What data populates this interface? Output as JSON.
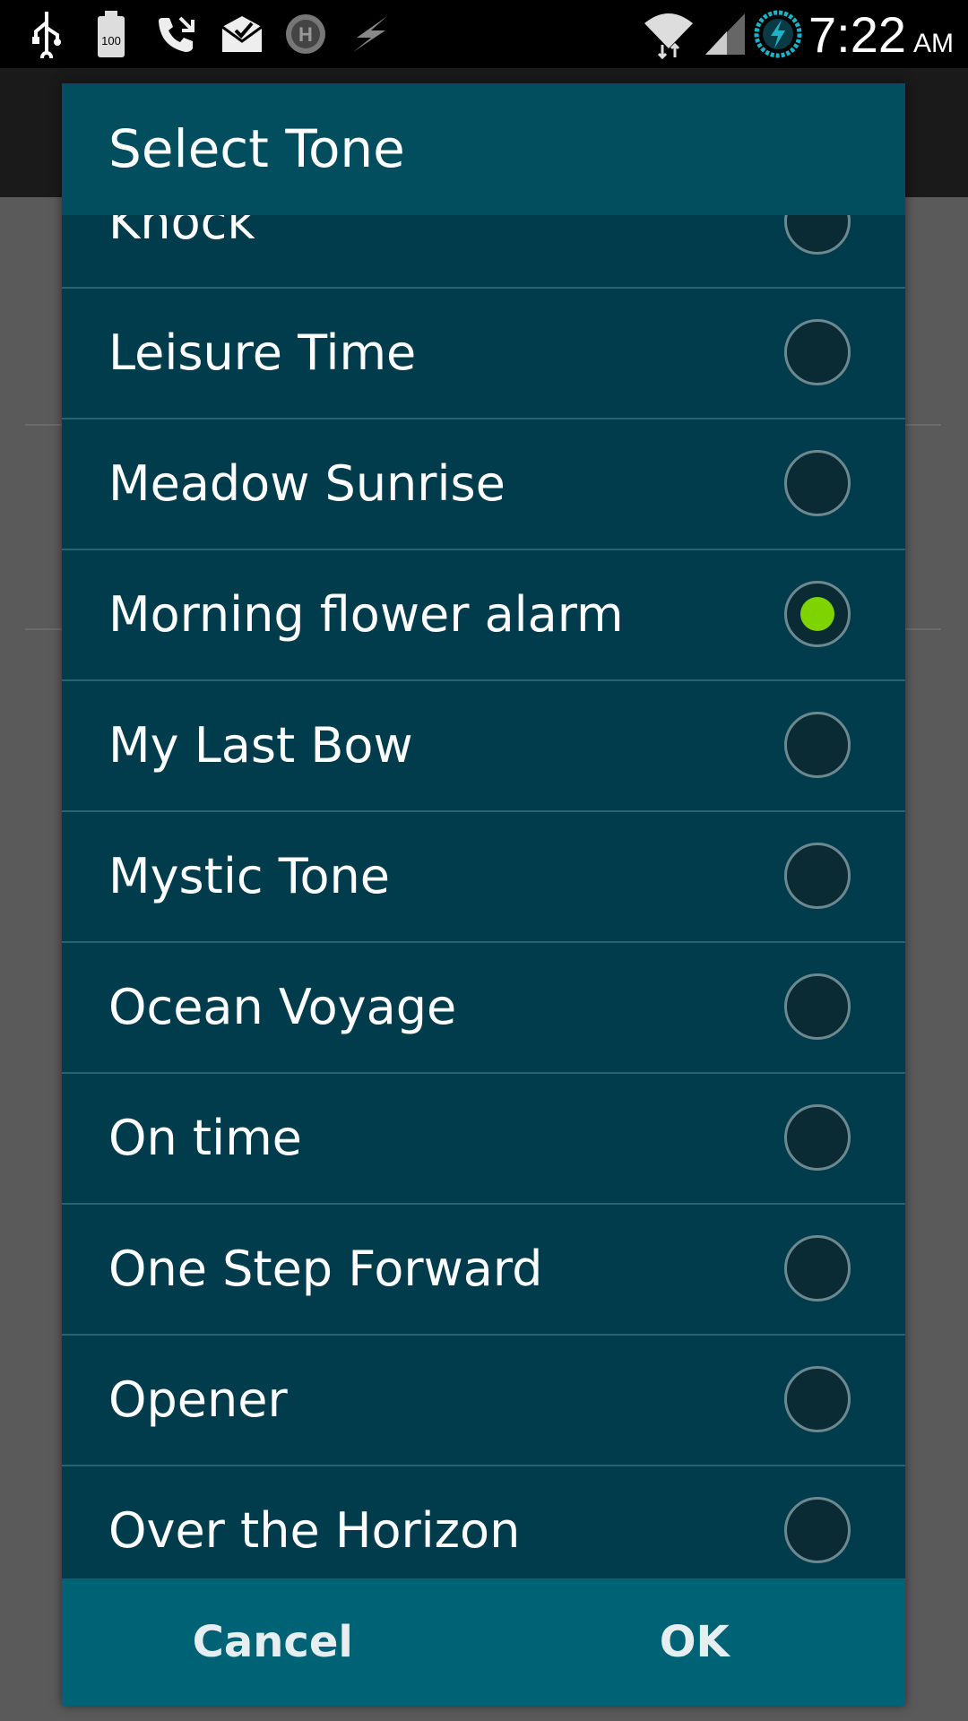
{
  "status_bar": {
    "time": "7:22",
    "ampm": "AM",
    "battery_level": "100",
    "icons_left": [
      "usb-icon",
      "battery-icon",
      "missed-call-icon",
      "mail-icon",
      "h-badge-icon",
      "flash-icon"
    ],
    "icons_right": [
      "wifi-icon",
      "signal-icon",
      "charging-ring-icon"
    ]
  },
  "dialog": {
    "title": "Select Tone",
    "items": [
      {
        "label": "Knock",
        "selected": false
      },
      {
        "label": "Leisure Time",
        "selected": false
      },
      {
        "label": "Meadow Sunrise",
        "selected": false
      },
      {
        "label": "Morning flower alarm",
        "selected": true
      },
      {
        "label": "My Last Bow",
        "selected": false
      },
      {
        "label": "Mystic Tone",
        "selected": false
      },
      {
        "label": "Ocean Voyage",
        "selected": false
      },
      {
        "label": "On time",
        "selected": false
      },
      {
        "label": "One Step Forward",
        "selected": false
      },
      {
        "label": "Opener",
        "selected": false
      },
      {
        "label": "Over the Horizon",
        "selected": false
      }
    ],
    "cancel_label": "Cancel",
    "ok_label": "OK"
  },
  "colors": {
    "accent": "#7fd400",
    "dialog_bg": "#003c4c",
    "header_bg": "#024d5e",
    "button_bar_bg": "#006275"
  }
}
